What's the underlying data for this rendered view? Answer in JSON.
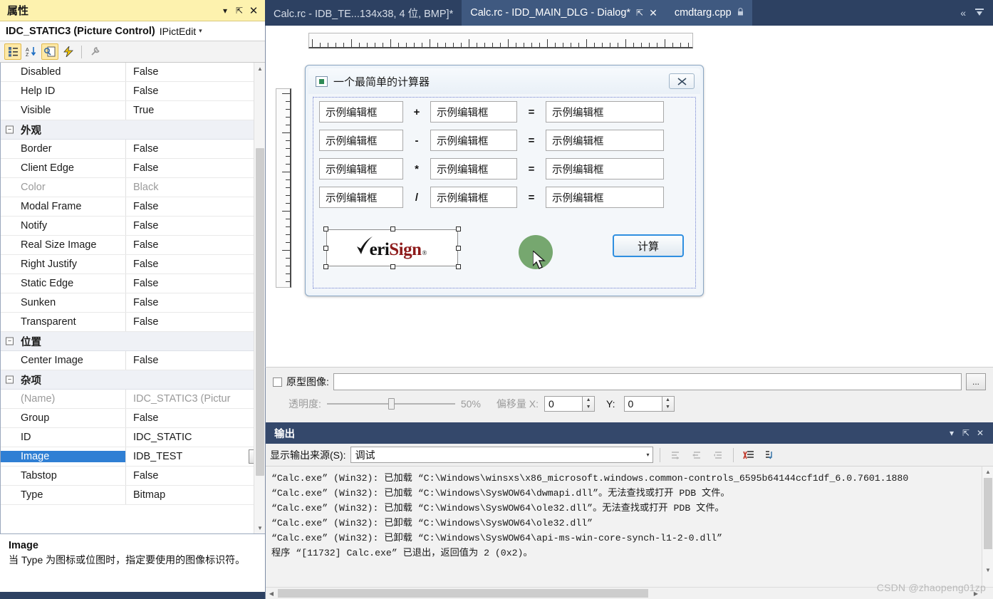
{
  "properties_panel": {
    "title": "属性",
    "titlebar_buttons": [
      {
        "name": "dropdown",
        "glyph": "▾"
      },
      {
        "name": "pin",
        "glyph": "⇱"
      },
      {
        "name": "close",
        "glyph": "✕"
      }
    ],
    "object_name": "IDC_STATIC3 (Picture Control)",
    "object_type": "IPictEdit",
    "object_arrow": "▾",
    "toolbar": [
      {
        "name": "categorized-icon",
        "glyph": "▤",
        "active": true
      },
      {
        "name": "alphabetical-sort-icon",
        "glyph": "↓",
        "active": false
      },
      {
        "name": "properties-icon",
        "glyph": "🗒",
        "active": true
      },
      {
        "name": "events-icon",
        "glyph": "⚡",
        "active": false
      },
      {
        "name": "property-pages-icon",
        "glyph": "🔧",
        "active": false
      }
    ],
    "rows": [
      {
        "name": "Disabled",
        "value": "False",
        "kind": "normal"
      },
      {
        "name": "Help ID",
        "value": "False",
        "kind": "normal"
      },
      {
        "name": "Visible",
        "value": "True",
        "kind": "normal"
      },
      {
        "name": "外观",
        "value": "",
        "kind": "category"
      },
      {
        "name": "Border",
        "value": "False",
        "kind": "normal"
      },
      {
        "name": "Client Edge",
        "value": "False",
        "kind": "normal"
      },
      {
        "name": "Color",
        "value": "Black",
        "kind": "dim"
      },
      {
        "name": "Modal Frame",
        "value": "False",
        "kind": "normal"
      },
      {
        "name": "Notify",
        "value": "False",
        "kind": "normal"
      },
      {
        "name": "Real Size Image",
        "value": "False",
        "kind": "normal"
      },
      {
        "name": "Right Justify",
        "value": "False",
        "kind": "normal"
      },
      {
        "name": "Static Edge",
        "value": "False",
        "kind": "normal"
      },
      {
        "name": "Sunken",
        "value": "False",
        "kind": "normal"
      },
      {
        "name": "Transparent",
        "value": "False",
        "kind": "normal"
      },
      {
        "name": "位置",
        "value": "",
        "kind": "category"
      },
      {
        "name": "Center Image",
        "value": "False",
        "kind": "normal"
      },
      {
        "name": "杂项",
        "value": "",
        "kind": "category"
      },
      {
        "name": "(Name)",
        "value": "IDC_STATIC3 (Pictur",
        "kind": "dim"
      },
      {
        "name": "Group",
        "value": "False",
        "kind": "normal"
      },
      {
        "name": "ID",
        "value": "IDC_STATIC",
        "kind": "normal"
      },
      {
        "name": "Image",
        "value": "IDB_TEST",
        "kind": "selected",
        "has_dropdown": true
      },
      {
        "name": "Tabstop",
        "value": "False",
        "kind": "normal"
      },
      {
        "name": "Type",
        "value": "Bitmap",
        "kind": "normal"
      }
    ],
    "description": {
      "title": "Image",
      "text": "当 Type 为图标或位图时，指定要使用的图像标识符。"
    },
    "scrollbar": {
      "up_glyph": "▲",
      "down_glyph": "▼"
    },
    "category_collapse_glyph": "−"
  },
  "tabs": [
    {
      "label": "Calc.rc - IDB_TE...134x38, 4 位, BMP]*",
      "active": false,
      "pin": false,
      "close": false,
      "lock": false
    },
    {
      "label": "Calc.rc - IDD_MAIN_DLG - Dialog*",
      "active": true,
      "pin": true,
      "close": true,
      "lock": false
    },
    {
      "label": "cmdtarg.cpp",
      "active": true,
      "pin": false,
      "close": false,
      "lock": true
    }
  ],
  "tabbar_right": [
    {
      "name": "scroll-tabs-left-icon",
      "glyph": "«"
    },
    {
      "name": "active-files-dropdown-icon",
      "glyph": "▼"
    }
  ],
  "tab_glyphs": {
    "pin": "⇱",
    "close": "✕",
    "lock": "🔒"
  },
  "dialog_editor": {
    "dialog_title": "一个最简单的计算器",
    "close_button_glyph": "✕",
    "rows": [
      {
        "operand1": "示例编辑框",
        "operator": "+",
        "operand2": "示例编辑框",
        "equals": "=",
        "result": "示例编辑框"
      },
      {
        "operand1": "示例编辑框",
        "operator": "-",
        "operand2": "示例编辑框",
        "equals": "=",
        "result": "示例编辑框"
      },
      {
        "operand1": "示例编辑框",
        "operator": "*",
        "operand2": "示例编辑框",
        "equals": "=",
        "result": "示例编辑框"
      },
      {
        "operand1": "示例编辑框",
        "operator": "/",
        "operand2": "示例编辑框",
        "equals": "=",
        "result": "示例编辑框"
      }
    ],
    "picture_control": {
      "brand_check": "✔",
      "brand_part1": "eri",
      "brand_part2": "Sign",
      "brand_tm": "®"
    },
    "calculate_button": "计算"
  },
  "prototype_bar": {
    "checkbox_label": "原型图像:",
    "path_value": "",
    "browse_label": "...",
    "transparency_label": "透明度:",
    "transparency_value": "50%",
    "offset_label": "偏移量 X:",
    "offset_x": "0",
    "offset_y_label": "Y:",
    "offset_y": "0"
  },
  "output_panel": {
    "title": "输出",
    "titlebar_buttons": [
      {
        "name": "dropdown",
        "glyph": "▾"
      },
      {
        "name": "pin",
        "glyph": "⇱"
      },
      {
        "name": "close",
        "glyph": "✕"
      }
    ],
    "source_label": "显示输出来源(S):",
    "source_value": "调试",
    "source_arrow": "▾",
    "toolbar_icons": [
      {
        "name": "go-to-message-icon",
        "glyph": "⇲",
        "dim": true
      },
      {
        "name": "previous-message-icon",
        "glyph": "⇤",
        "dim": true
      },
      {
        "name": "next-message-icon",
        "glyph": "⇥",
        "dim": true
      },
      {
        "name": "clear-output-icon",
        "glyph": "✖",
        "dim": false
      },
      {
        "name": "toggle-word-wrap-icon",
        "glyph": "⇄",
        "dim": false
      }
    ],
    "lines": [
      "“Calc.exe” (Win32): 已加载 “C:\\Windows\\winsxs\\x86_microsoft.windows.common-controls_6595b64144ccf1df_6.0.7601.1880",
      "“Calc.exe” (Win32): 已加载 “C:\\Windows\\SysWOW64\\dwmapi.dll”。无法查找或打开 PDB 文件。",
      "“Calc.exe” (Win32): 已加载 “C:\\Windows\\SysWOW64\\ole32.dll”。无法查找或打开 PDB 文件。",
      "“Calc.exe” (Win32): 已卸载 “C:\\Windows\\SysWOW64\\ole32.dll”",
      "“Calc.exe” (Win32): 已卸载 “C:\\Windows\\SysWOW64\\api-ms-win-core-synch-l1-2-0.dll”",
      "程序 “[11732] Calc.exe” 已退出，返回值为 2 (0x2)。"
    ],
    "scroll_glyphs": {
      "up": "▲",
      "down": "▼",
      "left": "◀",
      "right": "▶"
    }
  },
  "watermark": "CSDN @zhaopeng01zp",
  "colors": {
    "chrome": "#2d4162",
    "panel_header": "#34486b",
    "properties_title_bg": "#fdf2ae",
    "selection_blue": "#2f7fd4",
    "accent_border": "#2f8fe0"
  }
}
